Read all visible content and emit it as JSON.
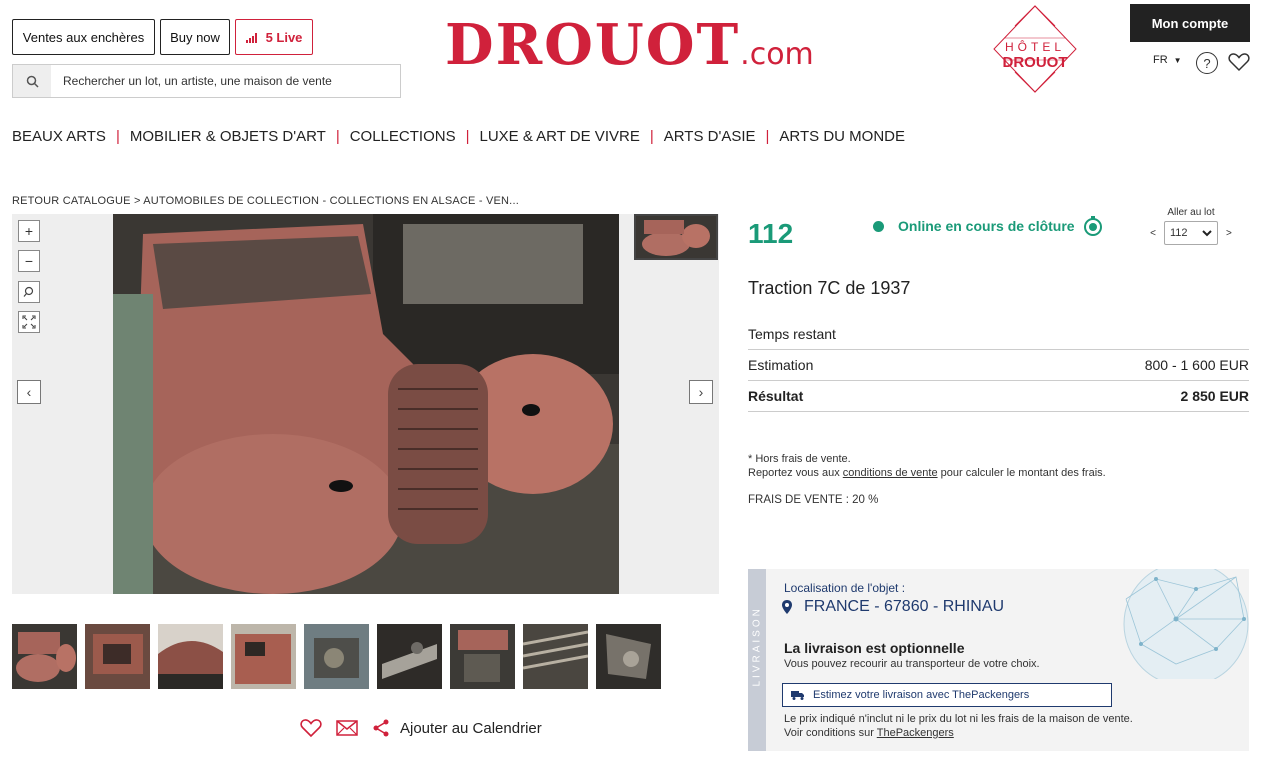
{
  "header": {
    "btn_encheres": "Ventes aux enchères",
    "btn_buynow": "Buy now",
    "btn_live": "5 Live",
    "search_placeholder": "Rechercher un lot, un artiste, une maison de vente",
    "logo_main": "DROUOT",
    "logo_suffix": ".com",
    "hotel_line1": "HÔTEL",
    "hotel_line2": "DROUOT",
    "mon_compte": "Mon compte",
    "lang": "FR"
  },
  "nav": [
    "BEAUX ARTS",
    "MOBILIER & OBJETS D'ART",
    "COLLECTIONS",
    "LUXE & ART DE VIVRE",
    "ARTS D'ASIE",
    "ARTS DU MONDE"
  ],
  "breadcrumb": "RETOUR CATALOGUE > AUTOMOBILES DE COLLECTION - COLLECTIONS EN ALSACE - VEN...",
  "viewer": {
    "zoom_in": "+",
    "zoom_out": "−",
    "prev": "‹",
    "next": "›"
  },
  "actions": {
    "calendar": "Ajouter au Calendrier"
  },
  "lot": {
    "number": "112",
    "status": "Online en cours de clôture",
    "aller_label": "Aller au lot",
    "aller_value": "112",
    "aller_prev": "<",
    "aller_next": ">",
    "title": "Traction 7C de 1937",
    "temps_label": "Temps restant",
    "estimation_label": "Estimation",
    "estimation_value": "800 - 1 600 EUR",
    "resultat_label": "Résultat",
    "resultat_value": "2 850 EUR",
    "hors_frais": "* Hors frais de vente.",
    "reportez_a": "Reportez vous aux ",
    "conditions_link": "conditions de vente",
    "reportez_b": " pour calculer le montant des frais.",
    "frais": "FRAIS DE VENTE : 20 %"
  },
  "livraison": {
    "band": "LIVRAISON",
    "loc_label": "Localisation de l'objet :",
    "location": "FRANCE - 67860 - RHINAU",
    "optional_title": "La livraison est optionnelle",
    "optional_sub": "Vous pouvez recourir au transporteur de votre choix.",
    "estimate_btn": "Estimez votre livraison avec ThePackengers",
    "disclaimer": "Le prix indiqué n'inclut ni le prix du lot ni les frais de la maison de vente.",
    "voir": "Voir conditions sur ",
    "voir_link": "ThePackengers"
  },
  "colors": {
    "brand_red": "#d0213b",
    "accent_green": "#1a9a78",
    "navy": "#1f3a6e"
  }
}
